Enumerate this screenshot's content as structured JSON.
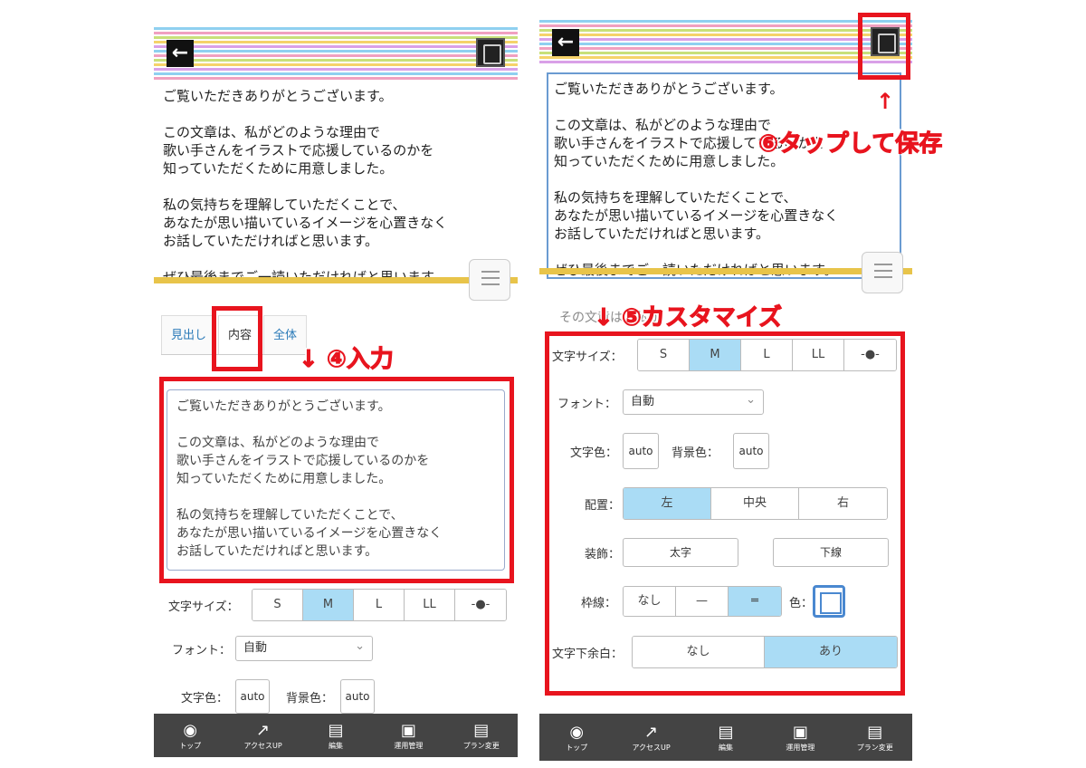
{
  "preview": {
    "p1": "ご覧いただきありがとうございます。",
    "p2": "この文章は、私がどのような理由で\n歌い手さんをイラストで応援しているのかを\n知っていただくために用意しました。",
    "p3": "私の気持ちを理解していただくことで、\nあなたが思い描いているイメージを心置きなく\nお話していただければと思います。",
    "p4": "ぜひ最後までご一読いただければと思います。"
  },
  "tabs": [
    {
      "label": "見出し"
    },
    {
      "label": "内容"
    },
    {
      "label": "全体"
    }
  ],
  "textarea": "ご覧いただきありがとうございます。\n\nこの文章は、私がどのような理由で\n歌い手さんをイラストで応援しているのかを\n知っていただくために用意しました。\n\n私の気持ちを理解していただくことで、\nあなたが思い描いているイメージを心置きなく\nお話していただければと思います。",
  "form": {
    "font_size_label": "文字サイズ：",
    "sizes": [
      "S",
      "M",
      "L",
      "LL",
      "-●-"
    ],
    "font_label": "フォント：",
    "font_value": "自動",
    "text_color_label": "文字色：",
    "text_color_value": "auto",
    "bg_color_label": "背景色：",
    "bg_color_value": "auto",
    "align_label": "配置：",
    "align_opts": [
      "左",
      "中央",
      "右"
    ],
    "deco_label": "装飾：",
    "bold": "太字",
    "underline": "下線",
    "border_label": "枠線：",
    "border_opts": [
      "なし",
      "—",
      "═"
    ],
    "color_label": "色：",
    "margin_label": "文字下余白：",
    "margin_opts": [
      "なし",
      "あり"
    ]
  },
  "bottom_nav": [
    {
      "label": "トップ",
      "icon": "radio-icon"
    },
    {
      "label": "アクセスUP",
      "icon": "trend-icon"
    },
    {
      "label": "編集",
      "icon": "document-icon"
    },
    {
      "label": "運用管理",
      "icon": "card-icon"
    },
    {
      "label": "プラン変更",
      "icon": "document-plus-icon"
    }
  ],
  "annotations": {
    "step4": "↓ ④入力",
    "step5": "↓ ⑤カスタマイズ",
    "step6": "⑥タップして保存",
    "up_arrow": "↑"
  },
  "partial_text": "その文章は、私が"
}
